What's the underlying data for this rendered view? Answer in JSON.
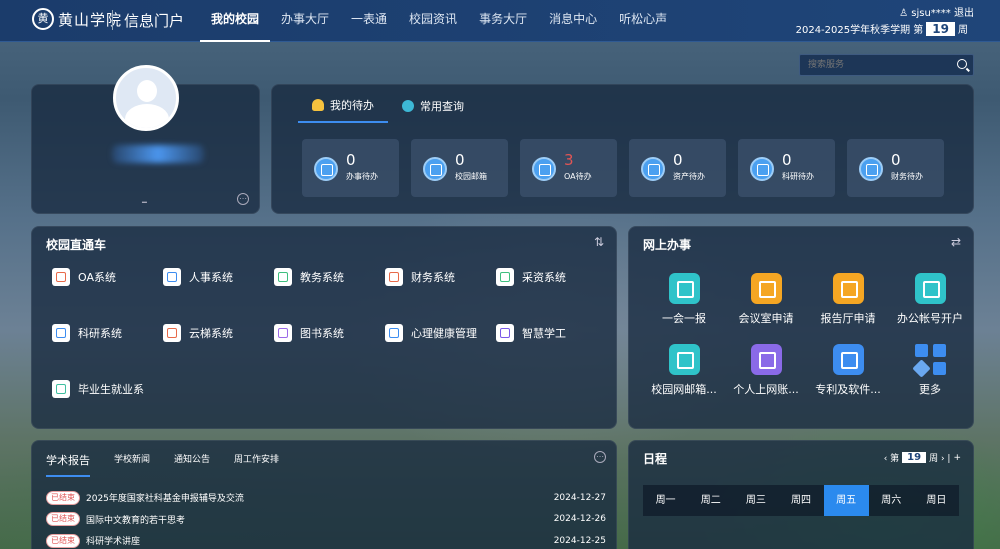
{
  "header": {
    "logo_char": "黄",
    "school_name": "黄山学院",
    "portal_title": "信息门户",
    "nav": [
      "我的校园",
      "办事大厅",
      "一表通",
      "校园资讯",
      "事务大厅",
      "消息中心",
      "听松心声"
    ],
    "user_name": "sjsu****",
    "logout": "退出",
    "term_text": "2024-2025学年秋季学期 第",
    "week_number": "19",
    "week_unit": "周"
  },
  "search": {
    "placeholder": "搜索服务"
  },
  "profile": {
    "mark": "━"
  },
  "todo": {
    "tabs": [
      "我的待办",
      "常用查询"
    ],
    "cards": [
      {
        "num": "0",
        "label": "办事待办",
        "highlight": false
      },
      {
        "num": "0",
        "label": "校园邮箱",
        "highlight": false
      },
      {
        "num": "3",
        "label": "OA待办",
        "highlight": true
      },
      {
        "num": "0",
        "label": "资产待办",
        "highlight": false
      },
      {
        "num": "0",
        "label": "科研待办",
        "highlight": false
      },
      {
        "num": "0",
        "label": "财务待办",
        "highlight": false
      }
    ]
  },
  "campus": {
    "title": "校园直通车",
    "ctrl": "⇅",
    "apps": [
      {
        "label": "OA系统",
        "color": "#e86a4a"
      },
      {
        "label": "人事系统",
        "color": "#3d8df0"
      },
      {
        "label": "教务系统",
        "color": "#3fbf7f"
      },
      {
        "label": "财务系统",
        "color": "#e86a4a"
      },
      {
        "label": "采资系统",
        "color": "#3fbf7f"
      },
      {
        "label": "科研系统",
        "color": "#3d8df0"
      },
      {
        "label": "云梯系统",
        "color": "#e86a4a"
      },
      {
        "label": "图书系统",
        "color": "#9b6ae8"
      },
      {
        "label": "心理健康管理",
        "color": "#3d8df0"
      },
      {
        "label": "智慧学工",
        "color": "#7b5ae8"
      },
      {
        "label": "毕业生就业系",
        "color": "#3fbfa0"
      }
    ]
  },
  "online": {
    "title": "网上办事",
    "ctrl": "⇄",
    "items": [
      {
        "label": "一会一报",
        "color": "#2fc3c9"
      },
      {
        "label": "会议室申请",
        "color": "#f5a623"
      },
      {
        "label": "报告厅申请",
        "color": "#f5a623"
      },
      {
        "label": "办公帐号开户",
        "color": "#2fc3c9"
      },
      {
        "label": "校园网邮箱...",
        "color": "#2fc3c9"
      },
      {
        "label": "个人上网账...",
        "color": "#8a6ae8"
      },
      {
        "label": "专利及软件...",
        "color": "#3d8df0"
      },
      {
        "label": "更多",
        "color": "#3d8df0"
      }
    ]
  },
  "news": {
    "tabs": [
      "学术报告",
      "学校新闻",
      "通知公告",
      "周工作安排"
    ],
    "rows": [
      {
        "badge": "已结束",
        "title": "2025年度国家社科基金申报辅导及交流",
        "date": "2024-12-27"
      },
      {
        "badge": "已结束",
        "title": "国际中文教育的若干思考",
        "date": "2024-12-26"
      },
      {
        "badge": "已结束",
        "title": "科研学术讲座",
        "date": "2024-12-25"
      }
    ]
  },
  "schedule": {
    "title": "日程",
    "prefix": "‹ 第",
    "week": "19",
    "suffix": "周 › |",
    "add": "+",
    "days": [
      "周一",
      "周二",
      "周三",
      "周四",
      "周五",
      "周六",
      "周日"
    ],
    "active_day": 4
  }
}
